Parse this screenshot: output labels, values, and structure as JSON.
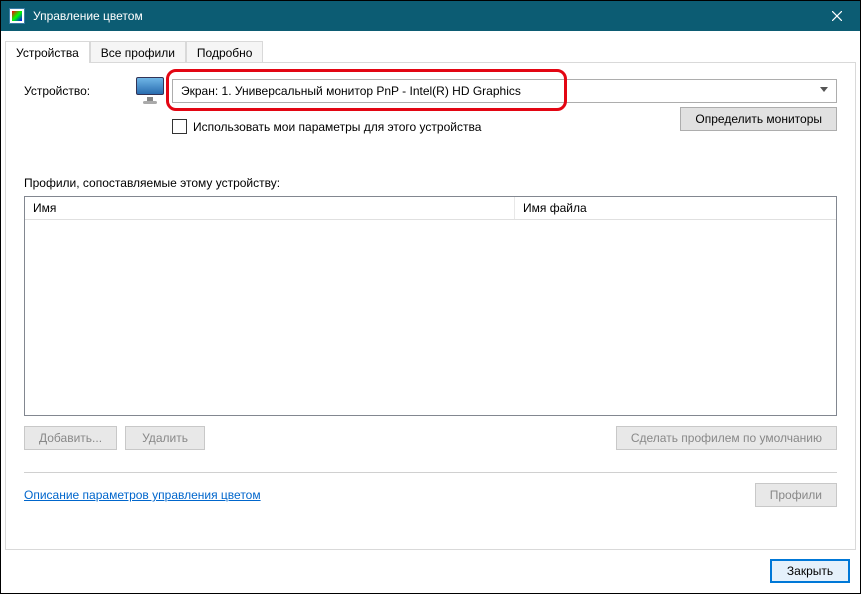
{
  "window": {
    "title": "Управление цветом"
  },
  "tabs": {
    "devices": "Устройства",
    "all_profiles": "Все профили",
    "advanced": "Подробно"
  },
  "device": {
    "label": "Устройство:",
    "selected": "Экран: 1. Универсальный монитор PnP - Intel(R) HD Graphics",
    "checkbox_label": "Использовать мои параметры для этого устройства",
    "identify_button": "Определить мониторы"
  },
  "profiles": {
    "section_label": "Профили, сопоставляемые этому устройству:",
    "columns": {
      "name": "Имя",
      "filename": "Имя файла"
    },
    "buttons": {
      "add": "Добавить...",
      "delete": "Удалить",
      "set_default": "Сделать профилем по умолчанию"
    }
  },
  "footer": {
    "help_link": "Описание параметров управления цветом",
    "profiles_button": "Профили",
    "close_button": "Закрыть"
  }
}
